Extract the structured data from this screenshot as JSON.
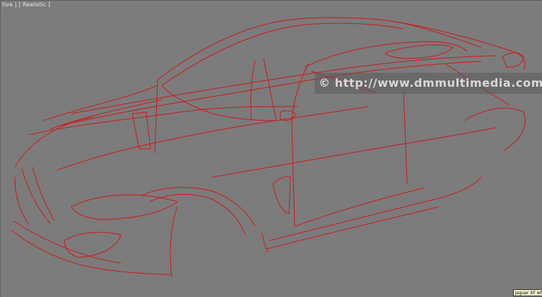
{
  "viewport": {
    "label_left": "tive ]",
    "label_shading": "[ Realistic ]",
    "wire_color": "#d01818",
    "background": "#7c7c7c"
  },
  "watermark": {
    "text": "© http://www.dmmultimedia.com"
  },
  "object_tooltip": {
    "text": "Jaguar XF wfr"
  }
}
